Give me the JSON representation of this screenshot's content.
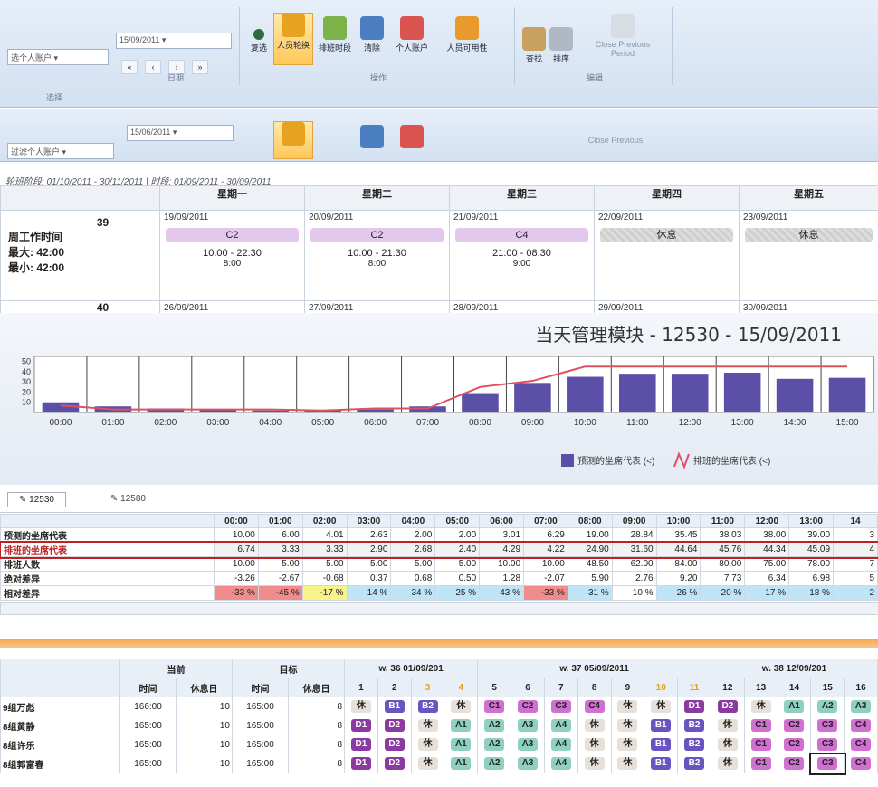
{
  "ribbon1": {
    "selector": "选个人账户",
    "date": "15/09/2011",
    "groups": [
      "选择",
      "日期",
      "操作",
      "编辑"
    ],
    "buttons": [
      "复选",
      "人员轮换",
      "排班时段",
      "清除",
      "个人账户",
      "人员可用性",
      "查找",
      "排序"
    ],
    "close": "Close Previous Period"
  },
  "ribbon2": {
    "selector": "过滤个人账户",
    "date": "15/06/2011",
    "close": "Close Previous"
  },
  "period_line": "轮班阶段: 01/10/2011 - 30/11/2011 | 时段: 01/09/2011 - 30/09/2011",
  "calendar": {
    "days": [
      "星期一",
      "星期二",
      "星期三",
      "星期四",
      "星期五"
    ],
    "week1": {
      "num": "39",
      "label": "周工作时间",
      "max": "最大: 42:00",
      "min": "最小: 42:00",
      "cells": [
        {
          "date": "19/09/2011",
          "shift": "C2",
          "time": "10:00 - 22:30",
          "dur": "8:00",
          "kind": "work"
        },
        {
          "date": "20/09/2011",
          "shift": "C2",
          "time": "10:00 - 21:30",
          "dur": "8:00",
          "kind": "work"
        },
        {
          "date": "21/09/2011",
          "shift": "C4",
          "time": "21:00 - 08:30",
          "dur": "9:00",
          "kind": "work"
        },
        {
          "date": "22/09/2011",
          "shift": "休息",
          "time": "",
          "dur": "",
          "kind": "rest"
        },
        {
          "date": "23/09/2011",
          "shift": "休息",
          "time": "",
          "dur": "",
          "kind": "rest"
        }
      ]
    },
    "week2": {
      "num": "40",
      "dates": [
        "26/09/2011",
        "27/09/2011",
        "28/09/2011",
        "29/09/2011",
        "30/09/2011"
      ]
    }
  },
  "chart_data": {
    "type": "bar",
    "title": "当天管理模块 - 12530 - 15/09/2011",
    "categories": [
      "00:00",
      "01:00",
      "02:00",
      "03:00",
      "04:00",
      "05:00",
      "06:00",
      "07:00",
      "08:00",
      "09:00",
      "10:00",
      "11:00",
      "12:00",
      "13:00",
      "14:00",
      "15:00"
    ],
    "series": [
      {
        "name": "预测的坐席代表 (<)",
        "type": "bar",
        "values": [
          10,
          6,
          4,
          3,
          2,
          2,
          3,
          6,
          19,
          29,
          35,
          38,
          38,
          39,
          33,
          34
        ]
      },
      {
        "name": "排班的坐席代表 (<)",
        "type": "line",
        "values": [
          7,
          3,
          3,
          3,
          3,
          2,
          4,
          4,
          25,
          31,
          45,
          45,
          45,
          45,
          45,
          45
        ]
      }
    ],
    "yticks": [
      10,
      20,
      30,
      40,
      50
    ],
    "ylim": [
      0,
      55
    ],
    "line_color": "#e05060",
    "bar_color": "#5b4fa8"
  },
  "tabs": [
    "12530",
    "12580"
  ],
  "intraday": {
    "hours": [
      "00:00",
      "01:00",
      "02:00",
      "03:00",
      "04:00",
      "05:00",
      "06:00",
      "07:00",
      "08:00",
      "09:00",
      "10:00",
      "11:00",
      "12:00",
      "13:00",
      "14"
    ],
    "rows": [
      {
        "label": "预测的坐席代表",
        "cells": [
          "10.00",
          "6.00",
          "4.01",
          "2.63",
          "2.00",
          "2.00",
          "3.01",
          "6.29",
          "19.00",
          "28.84",
          "35.45",
          "38.03",
          "38.00",
          "39.00",
          "3"
        ]
      },
      {
        "label": "排班的坐席代表",
        "cells": [
          "6.74",
          "3.33",
          "3.33",
          "2.90",
          "2.68",
          "2.40",
          "4.29",
          "4.22",
          "24.90",
          "31.60",
          "44.64",
          "45.76",
          "44.34",
          "45.09",
          "4"
        ]
      },
      {
        "label": "排班人数",
        "cells": [
          "10.00",
          "5.00",
          "5.00",
          "5.00",
          "5.00",
          "5.00",
          "10.00",
          "10.00",
          "48.50",
          "62.00",
          "84.00",
          "80.00",
          "75.00",
          "78.00",
          "7"
        ]
      },
      {
        "label": "绝对差异",
        "cells": [
          "-3.26",
          "-2.67",
          "-0.68",
          "0.37",
          "0.68",
          "0.50",
          "1.28",
          "-2.07",
          "5.90",
          "2.76",
          "9.20",
          "7.73",
          "6.34",
          "6.98",
          "5"
        ]
      },
      {
        "label": "相对差异",
        "cells": [
          "-33 %",
          "-45 %",
          "-17 %",
          "14 %",
          "34 %",
          "25 %",
          "43 %",
          "-33 %",
          "31 %",
          "10 %",
          "26 %",
          "20 %",
          "17 %",
          "18 %",
          "2"
        ]
      }
    ],
    "diff_colors": [
      "#f08c8c",
      "#f08c8c",
      "#f7f28a",
      "#bfe3f7",
      "#bfe3f7",
      "#bfe3f7",
      "#bfe3f7",
      "#f08c8c",
      "#bfe3f7",
      "#ffffff",
      "#bfe3f7",
      "#bfe3f7",
      "#bfe3f7",
      "#bfe3f7",
      "#bfe3f7"
    ]
  },
  "schedule": {
    "h_current": "当前",
    "h_target": "目标",
    "sub": [
      "时间",
      "休息日",
      "时间",
      "休息日"
    ],
    "weeks": [
      "w. 36 01/09/201",
      "w. 37 05/09/2011",
      "w. 38 12/09/201"
    ],
    "days": [
      "1",
      "2",
      "3",
      "4",
      "5",
      "6",
      "7",
      "8",
      "9",
      "10",
      "11",
      "12",
      "13",
      "14",
      "15",
      "16"
    ],
    "rows": [
      {
        "name": "9组万彪",
        "cur_time": "166:00",
        "cur_off": "10",
        "tgt_time": "165:00",
        "tgt_off": "8",
        "cells": [
          "休",
          "B1",
          "B2",
          "休",
          "C1",
          "C2",
          "C3",
          "C4",
          "休",
          "休",
          "D1",
          "D2",
          "休",
          "A1",
          "A2",
          "A3"
        ]
      },
      {
        "name": "8组黄静",
        "cur_time": "165:00",
        "cur_off": "10",
        "tgt_time": "165:00",
        "tgt_off": "8",
        "cells": [
          "D1",
          "D2",
          "休",
          "A1",
          "A2",
          "A3",
          "A4",
          "休",
          "休",
          "B1",
          "B2",
          "休",
          "C1",
          "C2",
          "C3",
          "C4"
        ]
      },
      {
        "name": "8组许乐",
        "cur_time": "165:00",
        "cur_off": "10",
        "tgt_time": "165:00",
        "tgt_off": "8",
        "cells": [
          "D1",
          "D2",
          "休",
          "A1",
          "A2",
          "A3",
          "A4",
          "休",
          "休",
          "B1",
          "B2",
          "休",
          "C1",
          "C2",
          "C3",
          "C4"
        ]
      },
      {
        "name": "8组郭富春",
        "cur_time": "165:00",
        "cur_off": "10",
        "tgt_time": "165:00",
        "tgt_off": "8",
        "cells": [
          "D1",
          "D2",
          "休",
          "A1",
          "A2",
          "A3",
          "A4",
          "休",
          "休",
          "B1",
          "B2",
          "休",
          "C1",
          "C2",
          "C3",
          "C4"
        ]
      }
    ]
  }
}
